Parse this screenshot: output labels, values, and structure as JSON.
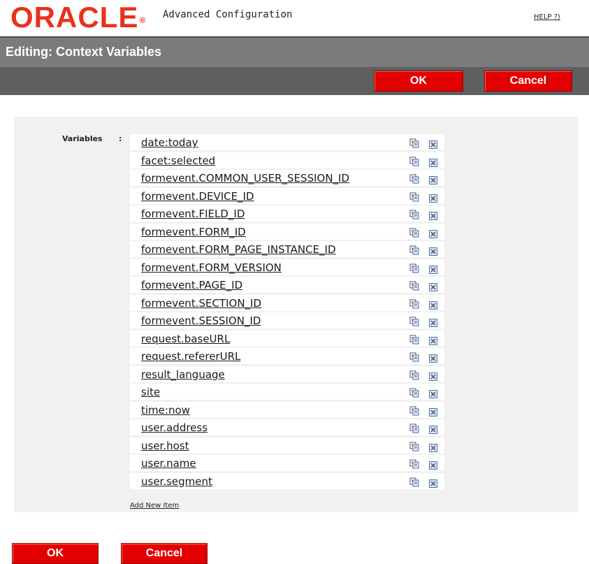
{
  "header": {
    "logo_text": "ORACLE",
    "logo_mark": "®",
    "app_title": "Advanced Configuration",
    "help_label": "HELP ?)"
  },
  "title_bar": {
    "title": "Editing: Context Variables"
  },
  "toolbar": {
    "ok_label": "OK",
    "cancel_label": "Cancel"
  },
  "form": {
    "variables_label": "Variables",
    "colon": ":",
    "variables": [
      "date:today",
      "facet:selected",
      "formevent.COMMON_USER_SESSION_ID",
      "formevent.DEVICE_ID",
      "formevent.FIELD_ID",
      "formevent.FORM_ID",
      "formevent.FORM_PAGE_INSTANCE_ID",
      "formevent.FORM_VERSION",
      "formevent.PAGE_ID",
      "formevent.SECTION_ID",
      "formevent.SESSION_ID",
      "request.baseURL",
      "request.refererURL",
      "result_language",
      "site",
      "time:now",
      "user.address",
      "user.host",
      "user.name",
      "user.segment"
    ],
    "add_label": "Add New Item",
    "row_icons": [
      "copy-icon",
      "delete-icon"
    ]
  },
  "footer": {
    "ok_label": "OK",
    "cancel_label": "Cancel"
  },
  "colors": {
    "brand_red": "#e8321c",
    "button_red": "#e30000",
    "title_bar": "#7b7b7b",
    "toolbar": "#5f5f5f",
    "panel": "#f1f1f1"
  }
}
